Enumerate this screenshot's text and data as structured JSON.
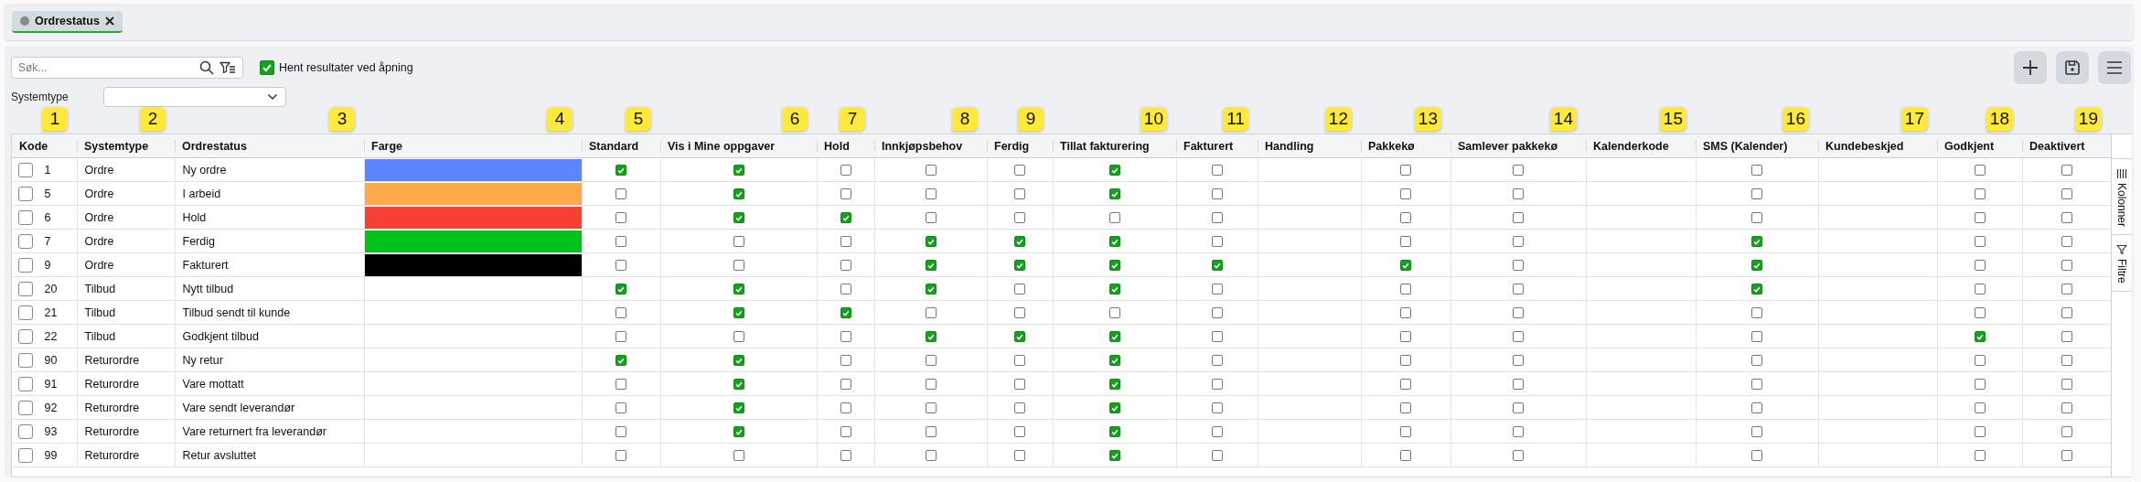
{
  "tabs": [
    {
      "label": "Ordrestatus",
      "selected": true
    }
  ],
  "toolbar": {
    "search": {
      "placeholder": "Søk..."
    },
    "auto_load": {
      "label": "Hent resultater ved åpning",
      "checked": true
    }
  },
  "filter": {
    "label": "Systemtype"
  },
  "table": {
    "columns": [
      {
        "label": "Kode",
        "kind": "code",
        "badge": "1"
      },
      {
        "label": "Systemtype",
        "kind": "text",
        "badge": "2"
      },
      {
        "label": "Ordrestatus",
        "kind": "text",
        "badge": "3"
      },
      {
        "label": "Farge",
        "kind": "color",
        "badge": "4"
      },
      {
        "label": "Standard",
        "kind": "check",
        "badge": "5"
      },
      {
        "label": "Vis i Mine oppgaver",
        "kind": "check",
        "badge": "6"
      },
      {
        "label": "Hold",
        "kind": "check",
        "badge": "7"
      },
      {
        "label": "Innkjøpsbehov",
        "kind": "check",
        "badge": "8"
      },
      {
        "label": "Ferdig",
        "kind": "check",
        "badge": "9"
      },
      {
        "label": "Tillat fakturering",
        "kind": "check",
        "badge": "10"
      },
      {
        "label": "Fakturert",
        "kind": "check",
        "badge": "11"
      },
      {
        "label": "Handling",
        "kind": "text",
        "badge": "12"
      },
      {
        "label": "Pakkekø",
        "kind": "check",
        "badge": "13"
      },
      {
        "label": "Samlever pakkekø",
        "kind": "check",
        "badge": "14"
      },
      {
        "label": "Kalenderkode",
        "kind": "text",
        "badge": "15"
      },
      {
        "label": "SMS (Kalender)",
        "kind": "check",
        "badge": "16"
      },
      {
        "label": "Kundebeskjed",
        "kind": "text",
        "badge": "17"
      },
      {
        "label": "Godkjent",
        "kind": "check",
        "badge": "18"
      },
      {
        "label": "Deaktivert",
        "kind": "check",
        "badge": "19"
      }
    ],
    "rows": [
      {
        "selected": false,
        "color": "#5b86ff",
        "cells": [
          "1",
          "Ordre",
          "Ny ordre",
          null,
          true,
          true,
          false,
          false,
          false,
          true,
          false,
          null,
          false,
          false,
          null,
          false,
          null,
          false,
          false
        ]
      },
      {
        "selected": false,
        "color": "#ffa94a",
        "cells": [
          "5",
          "Ordre",
          "I arbeid",
          null,
          false,
          true,
          false,
          false,
          false,
          true,
          false,
          null,
          false,
          false,
          null,
          false,
          null,
          false,
          false
        ]
      },
      {
        "selected": false,
        "color": "#f64034",
        "cells": [
          "6",
          "Ordre",
          "Hold",
          null,
          false,
          true,
          true,
          false,
          false,
          false,
          false,
          null,
          false,
          false,
          null,
          false,
          null,
          false,
          false
        ]
      },
      {
        "selected": false,
        "color": "#00c21a",
        "cells": [
          "7",
          "Ordre",
          "Ferdig",
          null,
          false,
          false,
          false,
          true,
          true,
          true,
          false,
          null,
          false,
          false,
          null,
          true,
          null,
          false,
          false
        ]
      },
      {
        "selected": false,
        "color": "#000000",
        "cells": [
          "9",
          "Ordre",
          "Fakturert",
          null,
          false,
          false,
          false,
          true,
          true,
          true,
          true,
          null,
          true,
          false,
          null,
          true,
          null,
          false,
          false
        ]
      },
      {
        "selected": false,
        "cells": [
          "20",
          "Tilbud",
          "Nytt tilbud",
          null,
          true,
          true,
          false,
          true,
          false,
          true,
          false,
          null,
          false,
          false,
          null,
          true,
          null,
          false,
          false
        ]
      },
      {
        "selected": false,
        "cells": [
          "21",
          "Tilbud",
          "Tilbud sendt til kunde",
          null,
          false,
          true,
          true,
          false,
          false,
          false,
          false,
          null,
          false,
          false,
          null,
          false,
          null,
          false,
          false
        ]
      },
      {
        "selected": false,
        "cells": [
          "22",
          "Tilbud",
          "Godkjent tilbud",
          null,
          false,
          false,
          false,
          true,
          true,
          true,
          false,
          null,
          false,
          false,
          null,
          false,
          null,
          true,
          false
        ]
      },
      {
        "selected": false,
        "cells": [
          "90",
          "Returordre",
          "Ny retur",
          null,
          true,
          true,
          false,
          false,
          false,
          true,
          false,
          null,
          false,
          false,
          null,
          false,
          null,
          false,
          false
        ]
      },
      {
        "selected": false,
        "cells": [
          "91",
          "Returordre",
          "Vare mottatt",
          null,
          false,
          true,
          false,
          false,
          false,
          true,
          false,
          null,
          false,
          false,
          null,
          false,
          null,
          false,
          false
        ]
      },
      {
        "selected": false,
        "cells": [
          "92",
          "Returordre",
          "Vare sendt leverandør",
          null,
          false,
          true,
          false,
          false,
          false,
          true,
          false,
          null,
          false,
          false,
          null,
          false,
          null,
          false,
          false
        ]
      },
      {
        "selected": false,
        "cells": [
          "93",
          "Returordre",
          "Vare returnert fra leverandør",
          null,
          false,
          true,
          false,
          false,
          false,
          true,
          false,
          null,
          false,
          false,
          null,
          false,
          null,
          false,
          false
        ]
      },
      {
        "selected": false,
        "cells": [
          "99",
          "Returordre",
          "Retur avsluttet",
          null,
          false,
          false,
          false,
          false,
          false,
          true,
          false,
          null,
          false,
          false,
          null,
          false,
          null,
          false,
          false
        ]
      }
    ]
  },
  "side_panel": [
    {
      "label": "Kolonner",
      "kind": "columns"
    },
    {
      "label": "Filtre",
      "kind": "filter"
    }
  ]
}
